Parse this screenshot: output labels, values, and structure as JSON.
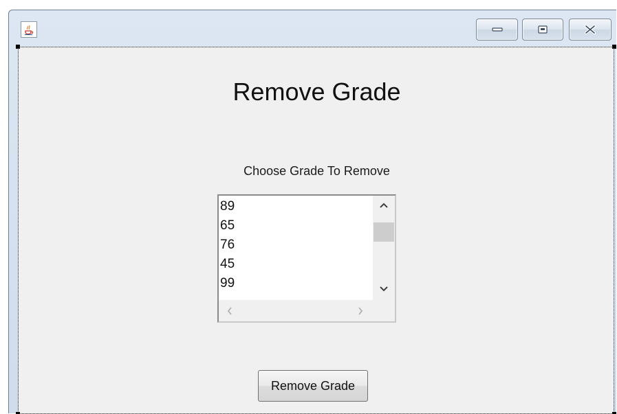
{
  "window": {
    "controls": {
      "minimize_icon": "minimize-icon",
      "maximize_icon": "maximize-icon",
      "close_icon": "close-icon"
    },
    "app_icon": "java-coffee-cup-icon"
  },
  "main": {
    "title": "Remove Grade",
    "prompt": "Choose Grade To Remove",
    "grade_list": {
      "items": [
        "89",
        "65",
        "76",
        "45",
        "99",
        "--"
      ],
      "vertical_scroll_position": 0.12,
      "vertical_visible_fraction": 0.2
    },
    "remove_button_label": "Remove Grade"
  },
  "colors": {
    "panel_background": "#f0f0f0",
    "titlebar": "#d6e2ef"
  }
}
